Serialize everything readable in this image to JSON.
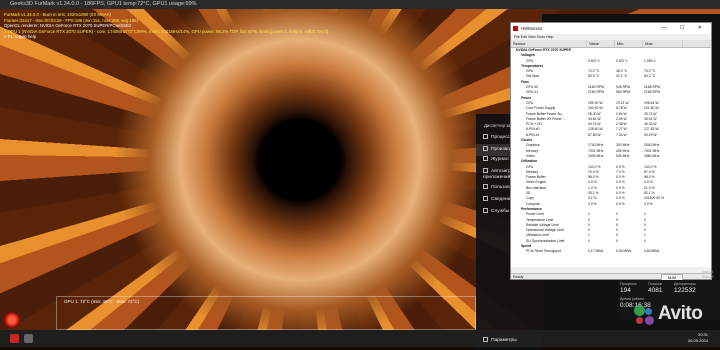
{
  "furmark": {
    "title": "Geeks3D FurMark v1.34.0.0 - 186FPS, GPU1 temp:72°C, GPU1 usage:99%",
    "window_controls": "—  ☐  ✕",
    "osd": [
      "FurMark v1.34.0.0 - Burn-in test, 1920x1080 (0X MSAA)",
      "Frames:33417 - time:00:03:29 - FPS:186 (min:151, max:208, avg:186)",
      "OpenGL renderer: NVIDIA GeForce RTX 2070 SUPER/PCIe/SSE2",
      "> GPU 1 (NVIDIA GeForce RTX 2070 SUPER) - core: 1740MHz/72°C/99%, mem: 7001MHz/14%, GPU power: 96.2% TDP, fan: 67%, limits:[power:1, temp:0, volt:0, OV:0]",
      "> F1: toggle help"
    ],
    "graph_label": "GPU 1: 72°C (min: 48°C - max: 72°C)"
  },
  "settings_menu": {
    "header": "Диспетчер задач",
    "items": [
      {
        "label": "Процессы",
        "active": false
      },
      {
        "label": "Производительность",
        "active": true
      },
      {
        "label": "Журнал приложений",
        "active": false
      },
      {
        "label": "Автозагрузка приложений",
        "active": false
      },
      {
        "label": "Пользователи",
        "active": false
      },
      {
        "label": "Сведения",
        "active": false
      },
      {
        "label": "Службы",
        "active": false
      }
    ],
    "footer": "Параметры"
  },
  "hwmonitor": {
    "title": "HWMonitor",
    "window_controls": "— ☐ ✕",
    "menu": "File  Edit  View  Tools  Help",
    "columns": [
      "Sensor",
      "Value",
      "Min",
      "Max"
    ],
    "rows": [
      {
        "l": 1,
        "n": "NVIDIA GeForce RTX 2070 SUPER",
        "v": "",
        "mi": "",
        "ma": "",
        "cat": true
      },
      {
        "l": 2,
        "n": "Voltages",
        "v": "",
        "mi": "",
        "ma": "",
        "cat": true
      },
      {
        "l": 3,
        "n": "GPU",
        "v": "0.837 V",
        "mi": "0.637 V",
        "ma": "1.050 V"
      },
      {
        "l": 2,
        "n": "Temperatures",
        "v": "",
        "mi": "",
        "ma": "",
        "cat": true
      },
      {
        "l": 3,
        "n": "GPU",
        "v": "72.0 °C",
        "mi": "38.0 °C",
        "ma": "73.0 °C"
      },
      {
        "l": 3,
        "n": "Hot Spot",
        "v": "83.9 °C",
        "mi": "42.1 °C",
        "ma": "84.2 °C"
      },
      {
        "l": 2,
        "n": "Fans",
        "v": "",
        "mi": "",
        "ma": "",
        "cat": true
      },
      {
        "l": 3,
        "n": "GPU #0",
        "v": "2160 RPM",
        "mi": "945 RPM",
        "ma": "2168 RPM"
      },
      {
        "l": 3,
        "n": "GPU #1",
        "v": "2160 RPM",
        "mi": "964 RPM",
        "ma": "2168 RPM"
      },
      {
        "l": 2,
        "n": "Power",
        "v": "",
        "mi": "",
        "ma": "",
        "cat": true
      },
      {
        "l": 3,
        "n": "GPU",
        "v": "255.30 W",
        "mi": "19.21 W",
        "ma": "298.44 W"
      },
      {
        "l": 3,
        "n": "Core Power Supply",
        "v": "160.40 W",
        "mi": "6.78 W",
        "ma": "201.60 W"
      },
      {
        "l": 3,
        "n": "Frame Buffer Power Su...",
        "v": "28.30 W",
        "mi": "0.84 W",
        "ma": "28.74 W"
      },
      {
        "l": 3,
        "n": "Frame Buffer I/O Power ...",
        "v": "34.81 W",
        "mi": "2.05 W",
        "ma": "35.51 W"
      },
      {
        "l": 3,
        "n": "PCIe +12V",
        "v": "44.74 W",
        "mi": "2.48 W",
        "ma": "45.33 W"
      },
      {
        "l": 3,
        "n": "8-PIN #0",
        "v": "125.40 W",
        "mi": "7.27 W",
        "ma": "127.63 W"
      },
      {
        "l": 3,
        "n": "8-PIN #1",
        "v": "87.80 W",
        "mi": "7.34 W",
        "ma": "93.29 W"
      },
      {
        "l": 2,
        "n": "Clocks",
        "v": "",
        "mi": "",
        "ma": "",
        "cat": true
      },
      {
        "l": 3,
        "n": "Graphics",
        "v": "1740 MHz",
        "mi": "300 MHz",
        "ma": "2040 MHz"
      },
      {
        "l": 3,
        "n": "Memory",
        "v": "7001 MHz",
        "mi": "405 MHz",
        "ma": "7001 MHz"
      },
      {
        "l": 3,
        "n": "Video",
        "v": "1605 MHz",
        "mi": "540 MHz",
        "ma": "1860 MHz"
      },
      {
        "l": 2,
        "n": "Utilization",
        "v": "",
        "mi": "",
        "ma": "",
        "cat": true
      },
      {
        "l": 3,
        "n": "GPU",
        "v": "100.0 %",
        "mi": "0.0 %",
        "ma": "100.0 %"
      },
      {
        "l": 3,
        "n": "Memory",
        "v": "19.0 %",
        "mi": "7.0 %",
        "ma": "87.0 %"
      },
      {
        "l": 3,
        "n": "Frame Buffer",
        "v": "98.0 %",
        "mi": "0.0 %",
        "ma": "98.0 %"
      },
      {
        "l": 3,
        "n": "Video Engine",
        "v": "0.0 %",
        "mi": "0.0 %",
        "ma": "0.0 %"
      },
      {
        "l": 3,
        "n": "Bus Interface",
        "v": "1.0 %",
        "mi": "0.0 %",
        "ma": "21.0 %"
      },
      {
        "l": 3,
        "n": "3D",
        "v": "25.1 %",
        "mi": "0.0 %",
        "ma": "82.1 %"
      },
      {
        "l": 3,
        "n": "Copy",
        "v": "0.1 %",
        "mi": "0.0 %",
        "ma": "101400.00 %"
      },
      {
        "l": 3,
        "n": "Compute",
        "v": "0.0 %",
        "mi": "0.0 %",
        "ma": "0.0 %"
      },
      {
        "l": 2,
        "n": "Performance",
        "v": "",
        "mi": "",
        "ma": "",
        "cat": true
      },
      {
        "l": 3,
        "n": "Power Limit",
        "v": "1",
        "mi": "0",
        "ma": "1"
      },
      {
        "l": 3,
        "n": "Temperature Limit",
        "v": "0",
        "mi": "0",
        "ma": "0"
      },
      {
        "l": 3,
        "n": "Reliable Voltage Limit",
        "v": "0",
        "mi": "0",
        "ma": "0"
      },
      {
        "l": 3,
        "n": "Operational Voltage Limit",
        "v": "0",
        "mi": "0",
        "ma": "0"
      },
      {
        "l": 3,
        "n": "Utilization Limit",
        "v": "1",
        "mi": "0",
        "ma": "1"
      },
      {
        "l": 3,
        "n": "SLI Synchronisation Limit",
        "v": "0",
        "mi": "0",
        "ma": "0"
      },
      {
        "l": 2,
        "n": "Speed",
        "v": "",
        "mi": "",
        "ma": "",
        "cat": true
      },
      {
        "l": 3,
        "n": "PCIe Read Throughput",
        "v": "0.17 MB/s",
        "mi": "0.00 MB/s",
        "ma": "4.83 MB/s"
      }
    ],
    "status": "Ready",
    "num": "NUM"
  },
  "perf": {
    "threads_label": "Потоков",
    "handles_label": "Дескрипторы",
    "processes_label": "Процессы",
    "processes": "194",
    "threads": "4081",
    "handles": "122532",
    "uptime_label": "Время работы",
    "uptime": "0:08:16:38"
  },
  "cores": [
    "Кэш L1:",
    "Кэш L2:",
    "Кэш L3:"
  ],
  "clock": {
    "time": "20:31",
    "date": "26.09.2024"
  },
  "watermark": "Avito"
}
